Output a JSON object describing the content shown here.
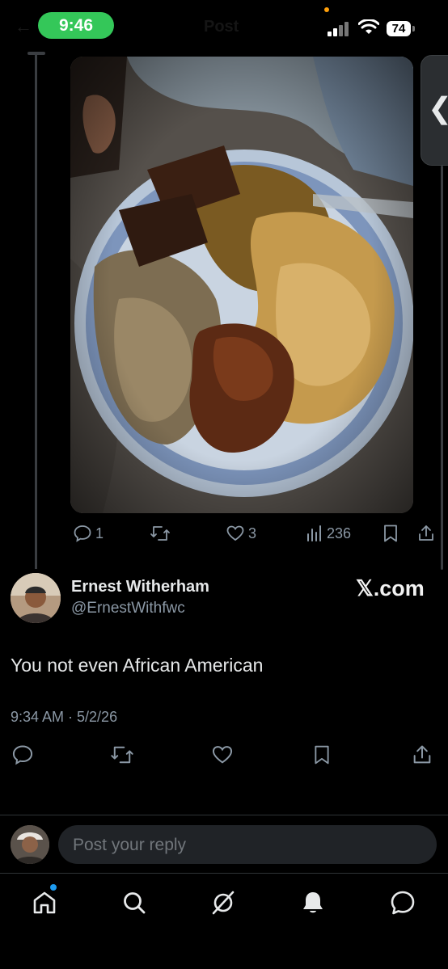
{
  "status_bar": {
    "time": "9:46",
    "battery": "74",
    "ghost_title": "Post",
    "ghost_back": "←"
  },
  "quoted_post": {
    "image": "photo of a paper plate with pasta, macaroni and cheese, rice, cornbread and wings",
    "reply_count": "1",
    "like_count": "3",
    "view_count": "236"
  },
  "side_tab": {
    "glyph": "❮"
  },
  "post": {
    "author_name": "Ernest Witherham",
    "author_handle": "@ErnestWithfwc",
    "watermark": "𝕏.com",
    "text": "You not even African American",
    "timestamp": "9:34 AM · 5/2/26"
  },
  "reply": {
    "placeholder": "Post your reply"
  },
  "nav": {
    "items": [
      "home-icon",
      "search-icon",
      "grok-icon",
      "notifications-icon",
      "messages-icon"
    ]
  },
  "colors": {
    "accent": "#1d9bf0",
    "muted": "#8b98a5",
    "time_pill": "#34c759"
  }
}
